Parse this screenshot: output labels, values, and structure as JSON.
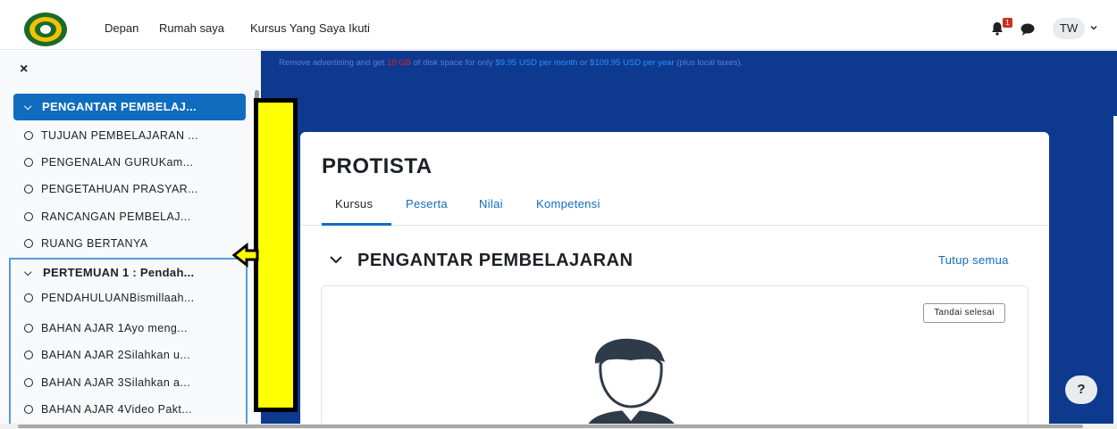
{
  "navbar": {
    "links": [
      "Depan",
      "Rumah saya",
      "Kursus Yang Saya Ikuti"
    ],
    "notification_count": "1",
    "user_initials": "TW",
    "icons": [
      "school-logo",
      "bell-icon",
      "chat-icon",
      "chevron-down-icon"
    ]
  },
  "sidebar": {
    "close_symbol": "×",
    "active_section": "PENGANTAR PEMBELAJ...",
    "section1_items": [
      "TUJUAN PEMBELAJARAN ...",
      "PENGENALAN GURUKam...",
      "PENGETAHUAN PRASYAR...",
      "RANCANGAN PEMBELAJ...",
      "RUANG BERTANYA"
    ],
    "section2_title": "PERTEMUAN 1 : Pendah...",
    "section2_items": [
      "PENDAHULUANBismillaah...",
      "BAHAN AJAR 1Ayo meng...",
      "BAHAN AJAR 2Silahkan u...",
      "BAHAN AJAR 3Silahkan a...",
      "BAHAN AJAR 4Video Pakt..."
    ]
  },
  "ad": {
    "part1": "Remove advertising and get ",
    "highlight": "10 GB",
    "part2": " of disk space for only ",
    "price_month": "$9.95 USD per month",
    "part3": " or ",
    "price_year": "$109.95 USD per year",
    "part4": " (plus local taxes)."
  },
  "course": {
    "title": "PROTISTA",
    "tabs": [
      "Kursus",
      "Peserta",
      "Nilai",
      "Kompetensi"
    ],
    "active_tab": "Kursus",
    "section_title": "PENGANTAR PEMBELAJARAN",
    "collapse_all": "Tutup semua",
    "mark_done": "Tandai selesai"
  },
  "help": {
    "label": "?"
  },
  "colors": {
    "primary": "#0f6cbf",
    "main_bg": "#0d3a8f",
    "annotation_yellow": "#ffff00",
    "badge_red": "#ca3120"
  }
}
